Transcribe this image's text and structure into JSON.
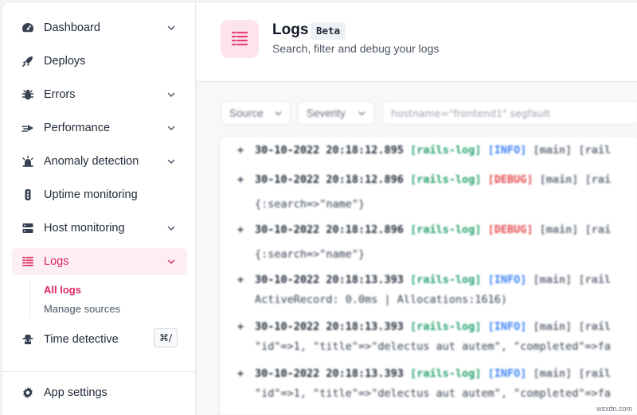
{
  "sidebar": {
    "items": [
      {
        "label": "Dashboard",
        "icon": "gauge-icon",
        "has_chevron": true
      },
      {
        "label": "Deploys",
        "icon": "rocket-icon",
        "has_chevron": false
      },
      {
        "label": "Errors",
        "icon": "bug-icon",
        "has_chevron": true
      },
      {
        "label": "Performance",
        "icon": "performance-icon",
        "has_chevron": true
      },
      {
        "label": "Anomaly detection",
        "icon": "alarm-icon",
        "has_chevron": true
      },
      {
        "label": "Uptime monitoring",
        "icon": "traffic-light-icon",
        "has_chevron": false
      },
      {
        "label": "Host monitoring",
        "icon": "server-icon",
        "has_chevron": true
      },
      {
        "label": "Logs",
        "icon": "logs-icon",
        "has_chevron": true,
        "active": true
      },
      {
        "label": "Time detective",
        "icon": "detective-icon",
        "shortcut": "⌘/"
      }
    ],
    "logs_sub": {
      "all_logs": "All logs",
      "manage_sources": "Manage sources"
    },
    "footer": {
      "label": "App settings",
      "icon": "gear-icon"
    }
  },
  "header": {
    "title": "Logs",
    "badge": "Beta",
    "subtitle": "Search, filter and debug your logs"
  },
  "filters": {
    "source_label": "Source",
    "severity_label": "Severity",
    "search_placeholder": "hostname=\"frontend1\" segfault"
  },
  "log_rows": [
    {
      "timestamp": "30-10-2022 20:18:12.895",
      "source": "[rails-log]",
      "level": "[INFO]",
      "thread": "[main] [rail"
    },
    {
      "timestamp": "30-10-2022 20:18:12.896",
      "source": "[rails-log]",
      "level": "[DEBUG]",
      "thread": "[main] [rai",
      "continuation": "{:search=>\"name\"}"
    },
    {
      "timestamp": "30-10-2022 20:18:12.896",
      "source": "[rails-log]",
      "level": "[DEBUG]",
      "thread": "[main] [rai",
      "continuation": "{:search=>\"name\"}"
    },
    {
      "timestamp": "30-10-2022 20:18:13.393",
      "source": "[rails-log]",
      "level": "[INFO]",
      "thread": "[main] [rail",
      "continuation": "ActiveRecord: 0.0ms | Allocations:1616)"
    },
    {
      "timestamp": "30-10-2022 20:18:13.393",
      "source": "[rails-log]",
      "level": "[INFO]",
      "thread": "[main] [rail",
      "continuation": "\"id\"=>1, \"title\"=>\"delectus aut autem\", \"completed\"=>fa"
    },
    {
      "timestamp": "30-10-2022 20:18:13.393",
      "source": "[rails-log]",
      "level": "[INFO]",
      "thread": "[main] [rail",
      "continuation": "\"id\"=>1, \"title\"=>\"delectus aut autem\", \"completed\"=>fa"
    }
  ],
  "watermark": "wsxdn.com",
  "colors": {
    "accent": "#db2760",
    "accent_bg": "#fdeef1",
    "info": "#3b82f6",
    "debug": "#e5484d",
    "source": "#22a06b"
  }
}
